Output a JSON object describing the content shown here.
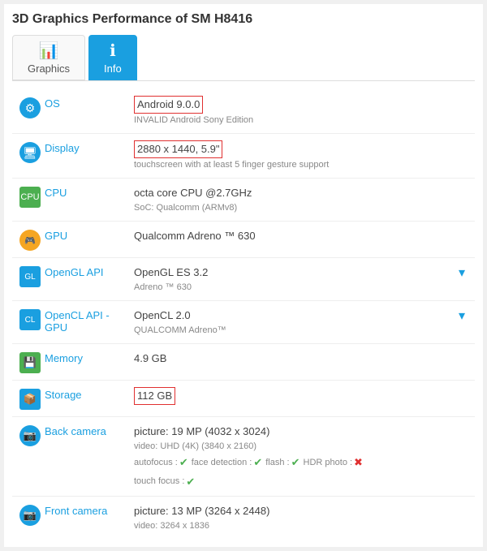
{
  "page": {
    "title": "3D Graphics Performance of SM H8416"
  },
  "tabs": [
    {
      "id": "graphics",
      "label": "Graphics",
      "icon": "📊",
      "active": false
    },
    {
      "id": "info",
      "label": "Info",
      "icon": "ℹ",
      "active": true
    }
  ],
  "rows": [
    {
      "id": "os",
      "icon": "⚙",
      "iconStyle": "blue circle",
      "label": "OS",
      "mainVal": "Android 9.0.0",
      "mainHighlight": true,
      "subVal": "INVALID Android Sony Edition",
      "hasDropdown": false
    },
    {
      "id": "display",
      "icon": "🖥",
      "iconStyle": "blue circle",
      "label": "Display",
      "mainVal": "2880 x 1440, 5.9\"",
      "mainHighlight": true,
      "subVal": "touchscreen with at least 5 finger gesture support",
      "hasDropdown": false
    },
    {
      "id": "cpu",
      "icon": "⚡",
      "iconStyle": "green square",
      "label": "CPU",
      "mainVal": "octa core CPU @2.7GHz",
      "mainHighlight": false,
      "subVal": "SoC: Qualcomm (ARMv8)",
      "hasDropdown": false
    },
    {
      "id": "gpu",
      "icon": "🎮",
      "iconStyle": "orange circle",
      "label": "GPU",
      "mainVal": "Qualcomm Adreno ™ 630",
      "mainHighlight": false,
      "subVal": "",
      "hasDropdown": false
    },
    {
      "id": "opengl",
      "icon": "🔷",
      "iconStyle": "blue square",
      "label": "OpenGL API",
      "mainVal": "OpenGL ES 3.2",
      "mainHighlight": false,
      "subVal": "Adreno ™ 630",
      "hasDropdown": true
    },
    {
      "id": "opencl",
      "icon": "🔷",
      "iconStyle": "blue square",
      "label": "OpenCL API - GPU",
      "mainVal": "OpenCL 2.0",
      "mainHighlight": false,
      "subVal": "QUALCOMM Adreno™",
      "hasDropdown": true
    },
    {
      "id": "memory",
      "icon": "💾",
      "iconStyle": "green square",
      "label": "Memory",
      "mainVal": "4.9 GB",
      "mainHighlight": false,
      "subVal": "",
      "hasDropdown": false
    },
    {
      "id": "storage",
      "icon": "📦",
      "iconStyle": "blue square",
      "label": "Storage",
      "mainVal": "112 GB",
      "mainHighlight": true,
      "subVal": "",
      "hasDropdown": false
    },
    {
      "id": "backcamera",
      "icon": "📷",
      "iconStyle": "blue circle",
      "label": "Back camera",
      "mainVal": "picture: 19 MP (4032 x 3024)",
      "mainHighlight": false,
      "subVal": "video: UHD (4K) (3840 x 2160)",
      "features": [
        {
          "label": "autofocus :",
          "val": "check"
        },
        {
          "label": "face detection :",
          "val": "check"
        },
        {
          "label": "flash :",
          "val": "check"
        },
        {
          "label": "HDR photo :",
          "val": "cross"
        }
      ],
      "features2": [
        {
          "label": "touch focus :",
          "val": "check"
        }
      ],
      "hasDropdown": false
    },
    {
      "id": "frontcamera",
      "icon": "📷",
      "iconStyle": "blue circle",
      "label": "Front camera",
      "mainVal": "picture: 13 MP (3264 x 2448)",
      "mainHighlight": false,
      "subVal": "video: 3264 x 1836",
      "hasDropdown": false
    }
  ],
  "icons": {
    "dropdown": "▾",
    "check": "✔",
    "cross": "✖"
  }
}
